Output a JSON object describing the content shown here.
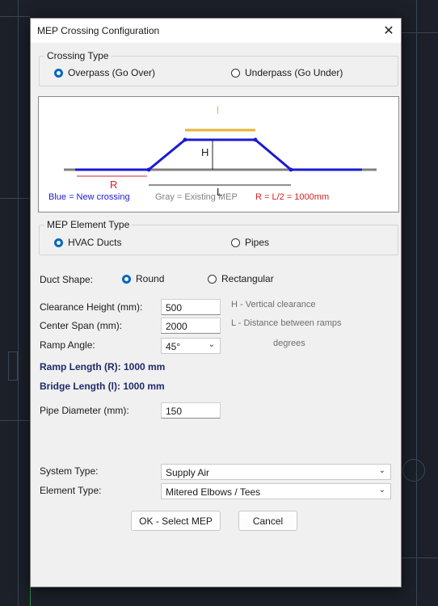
{
  "window": {
    "title": "MEP Crossing Configuration",
    "close_glyph": "✕"
  },
  "crossing_type": {
    "group_label": "Crossing Type",
    "options": [
      {
        "label": "Overpass (Go Over)",
        "selected": true
      },
      {
        "label": "Underpass (Go Under)",
        "selected": false
      }
    ]
  },
  "diagram": {
    "l_label": "l",
    "h_label": "H",
    "r_label": "R",
    "L_label": "L",
    "legend_blue": "Blue = New crossing",
    "legend_gray": "Gray = Existing MEP",
    "legend_r": "R = L/2 = 1000mm",
    "colors": {
      "blue": "#1a1ad6",
      "gray": "#808080",
      "red": "#d42020",
      "orange": "#e8b33a"
    }
  },
  "element_type": {
    "group_label": "MEP Element Type",
    "options": [
      {
        "label": "HVAC Ducts",
        "selected": true
      },
      {
        "label": "Pipes",
        "selected": false
      }
    ]
  },
  "duct_shape": {
    "label": "Duct Shape:",
    "options": [
      {
        "label": "Round",
        "selected": true
      },
      {
        "label": "Rectangular",
        "selected": false
      }
    ]
  },
  "fields": {
    "clearance_label": "Clearance Height (mm):",
    "clearance_value": "500",
    "clearance_hint": "H - Vertical clearance",
    "span_label": "Center Span (mm):",
    "span_value": "2000",
    "span_hint": "L - Distance between ramps",
    "angle_label": "Ramp Angle:",
    "angle_value": "45°",
    "angle_hint": "degrees",
    "ramp_length": "Ramp Length (R): 1000 mm",
    "bridge_length": "Bridge Length (l): 1000 mm",
    "pipe_diameter_label": "Pipe Diameter (mm):",
    "pipe_diameter_value": "150",
    "system_type_label": "System Type:",
    "system_type_value": "Supply Air",
    "element_type_label": "Element Type:",
    "element_type_value": "Mitered Elbows / Tees"
  },
  "buttons": {
    "ok": "OK - Select MEP",
    "cancel": "Cancel"
  }
}
